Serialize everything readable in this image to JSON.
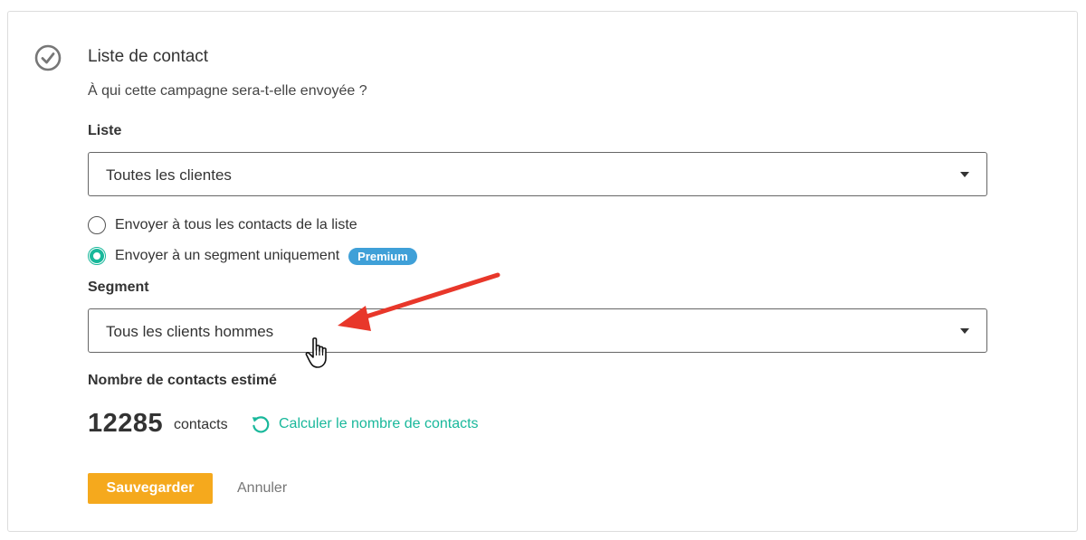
{
  "section": {
    "title": "Liste de contact",
    "subtitle": "À qui cette campagne sera-t-elle envoyée ?"
  },
  "list": {
    "label": "Liste",
    "selected": "Toutes les clientes"
  },
  "options": {
    "all_label": "Envoyer à tous les contacts de la liste",
    "segment_label": "Envoyer à un segment uniquement",
    "premium_badge": "Premium",
    "selected": "segment"
  },
  "segment": {
    "label": "Segment",
    "selected": "Tous les clients hommes"
  },
  "estimate": {
    "label": "Nombre de contacts estimé",
    "count": "12285",
    "unit": "contacts",
    "calc_link": "Calculer le nombre de contacts"
  },
  "actions": {
    "save": "Sauvegarder",
    "cancel": "Annuler"
  },
  "icons": {
    "status": "check-circle-icon",
    "calc": "refresh-icon",
    "select_caret": "caret-down-icon",
    "cursor": "hand-pointer-icon",
    "annotation": "red-arrow"
  },
  "colors": {
    "accent_green": "#19b89b",
    "save_orange": "#f5a91d",
    "premium_blue": "#3fa0d8",
    "annotation_red": "#e8372a"
  }
}
